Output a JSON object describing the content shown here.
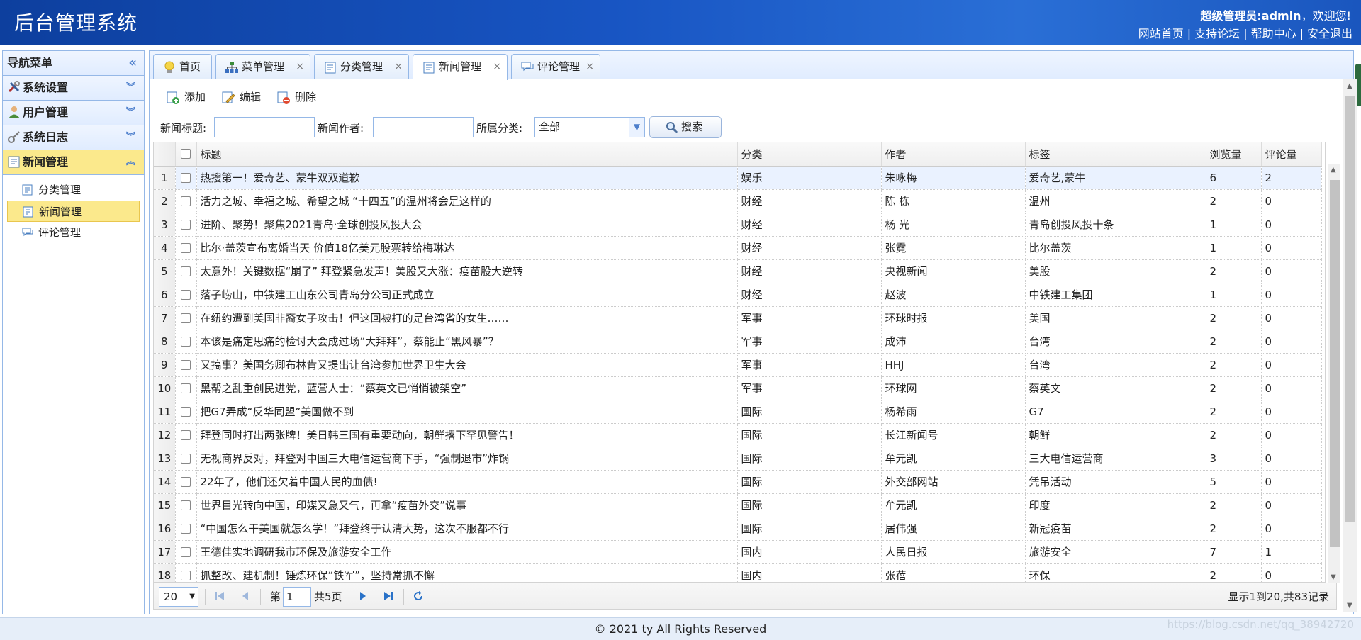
{
  "header": {
    "app_title": "后台管理系统",
    "user_role": "超级管理员:admin",
    "welcome": "，欢迎您!",
    "links": [
      "网站首页",
      "支持论坛",
      "帮助中心",
      "安全退出"
    ]
  },
  "nav": {
    "title": "导航菜单",
    "groups": [
      {
        "label": "系统设置"
      },
      {
        "label": "用户管理"
      },
      {
        "label": "系统日志"
      },
      {
        "label": "新闻管理"
      }
    ],
    "items": [
      {
        "label": "分类管理"
      },
      {
        "label": "新闻管理"
      },
      {
        "label": "评论管理"
      }
    ]
  },
  "tabs": [
    {
      "label": "首页"
    },
    {
      "label": "菜单管理"
    },
    {
      "label": "分类管理"
    },
    {
      "label": "新闻管理"
    },
    {
      "label": "评论管理"
    }
  ],
  "toolbar": {
    "add": "添加",
    "edit": "编辑",
    "delete": "删除"
  },
  "search": {
    "title_label": "新闻标题:",
    "title_value": "",
    "author_label": "新闻作者:",
    "author_value": "",
    "category_label": "所属分类:",
    "category_value": "全部",
    "button": "搜索"
  },
  "grid": {
    "columns": [
      "标题",
      "分类",
      "作者",
      "标签",
      "浏览量",
      "评论量"
    ],
    "rows": [
      {
        "n": "1",
        "title": "热搜第一！爱奇艺、蒙牛双双道歉",
        "cat": "娱乐",
        "author": "朱咏梅",
        "tags": "爱奇艺,蒙牛",
        "views": "6",
        "comments": "2"
      },
      {
        "n": "2",
        "title": "活力之城、幸福之城、希望之城 “十四五”的温州将会是这样的",
        "cat": "财经",
        "author": "陈 栋",
        "tags": "温州",
        "views": "2",
        "comments": "0"
      },
      {
        "n": "3",
        "title": "进阶、聚势！聚焦2021青岛·全球创投风投大会",
        "cat": "财经",
        "author": "杨 光",
        "tags": "青岛创投风投十条",
        "views": "1",
        "comments": "0"
      },
      {
        "n": "4",
        "title": "比尔·盖茨宣布离婚当天 价值18亿美元股票转给梅琳达",
        "cat": "财经",
        "author": "张霓",
        "tags": "比尔盖茨",
        "views": "1",
        "comments": "0"
      },
      {
        "n": "5",
        "title": "太意外！关键数据“崩了” 拜登紧急发声！美股又大涨：疫苗股大逆转",
        "cat": "财经",
        "author": "央视新闻",
        "tags": "美股",
        "views": "2",
        "comments": "0"
      },
      {
        "n": "6",
        "title": "落子崂山，中铁建工山东公司青岛分公司正式成立",
        "cat": "财经",
        "author": "赵波",
        "tags": "中铁建工集团",
        "views": "1",
        "comments": "0"
      },
      {
        "n": "7",
        "title": "在纽约遭到美国非裔女子攻击！但这回被打的是台湾省的女生……",
        "cat": "军事",
        "author": "环球时报",
        "tags": "美国",
        "views": "2",
        "comments": "0"
      },
      {
        "n": "8",
        "title": "本该是痛定思痛的检讨大会成过场“大拜拜”，蔡能止“黑风暴”？",
        "cat": "军事",
        "author": "成沛",
        "tags": "台湾",
        "views": "2",
        "comments": "0"
      },
      {
        "n": "9",
        "title": "又搞事？美国务卿布林肯又提出让台湾参加世界卫生大会",
        "cat": "军事",
        "author": "HHJ",
        "tags": "台湾",
        "views": "2",
        "comments": "0"
      },
      {
        "n": "10",
        "title": "黑帮之乱重创民进党，蓝营人士：“蔡英文已悄悄被架空”",
        "cat": "军事",
        "author": "环球网",
        "tags": "蔡英文",
        "views": "2",
        "comments": "0"
      },
      {
        "n": "11",
        "title": "把G7弄成“反华同盟”美国做不到",
        "cat": "国际",
        "author": "杨希雨",
        "tags": "G7",
        "views": "2",
        "comments": "0"
      },
      {
        "n": "12",
        "title": "拜登同时打出两张牌！美日韩三国有重要动向，朝鲜撂下罕见警告！",
        "cat": "国际",
        "author": "长江新闻号",
        "tags": "朝鲜",
        "views": "2",
        "comments": "0"
      },
      {
        "n": "13",
        "title": "无视商界反对，拜登对中国三大电信运营商下手，“强制退市”炸锅",
        "cat": "国际",
        "author": "牟元凯",
        "tags": "三大电信运营商",
        "views": "3",
        "comments": "0"
      },
      {
        "n": "14",
        "title": "22年了，他们还欠着中国人民的血债!",
        "cat": "国际",
        "author": "外交部网站",
        "tags": "凭吊活动",
        "views": "5",
        "comments": "0"
      },
      {
        "n": "15",
        "title": "世界目光转向中国，印媒又急又气，再拿“疫苗外交”说事",
        "cat": "国际",
        "author": "牟元凯",
        "tags": "印度",
        "views": "2",
        "comments": "0"
      },
      {
        "n": "16",
        "title": "“中国怎么干美国就怎么学！”拜登终于认清大势，这次不服都不行",
        "cat": "国际",
        "author": "居伟强",
        "tags": "新冠疫苗",
        "views": "2",
        "comments": "0"
      },
      {
        "n": "17",
        "title": "王德佳实地调研我市环保及旅游安全工作",
        "cat": "国内",
        "author": "人民日报",
        "tags": "旅游安全",
        "views": "7",
        "comments": "1"
      },
      {
        "n": "18",
        "title": "抓整改、建机制！锤炼环保“铁军”，坚持常抓不懈",
        "cat": "国内",
        "author": "张蓓",
        "tags": "环保",
        "views": "2",
        "comments": "0"
      }
    ]
  },
  "pager": {
    "page_size": "20",
    "page_prefix": "第",
    "page_number": "1",
    "page_total": "共5页",
    "info": "显示1到20,共83记录"
  },
  "footer": {
    "copyright": "© 2021 ty All Rights Reserved",
    "watermark": "https://blog.csdn.net/qq_38942720"
  },
  "colors": {
    "header_bg": "#1855c3",
    "panel_border": "#95b8e7",
    "active_yellow": "#fbe98c"
  }
}
